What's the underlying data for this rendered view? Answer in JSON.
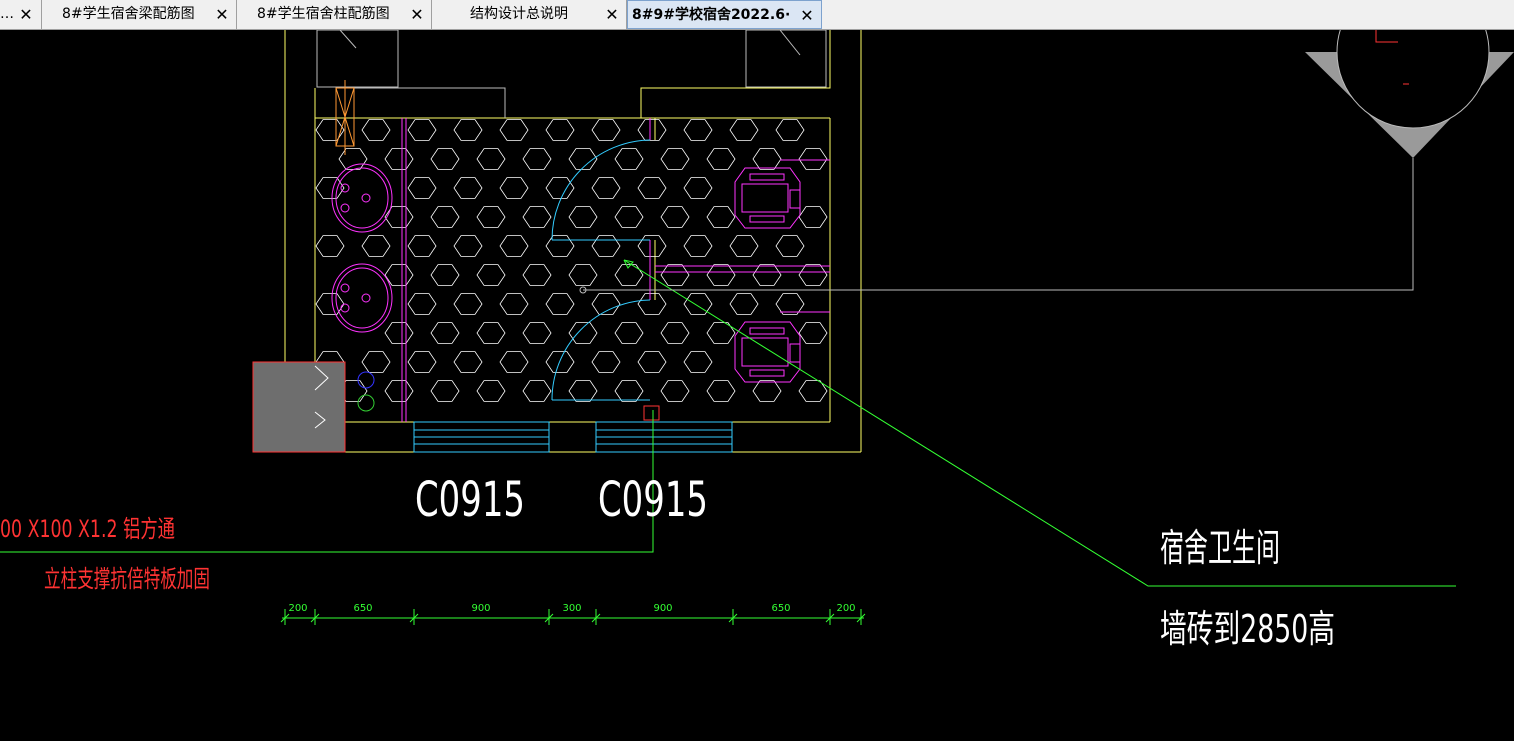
{
  "tabs": [
    {
      "label": "…",
      "active": false
    },
    {
      "label": "8#学生宿舍梁配筋图",
      "active": false
    },
    {
      "label": "8#学生宿舍柱配筋图",
      "active": false
    },
    {
      "label": "结构设计总说明",
      "active": false
    },
    {
      "label": "8#9#学校宿舍2022.6·",
      "active": true
    }
  ],
  "close_glyph": "✕",
  "drawing": {
    "window_labels": [
      "C0915",
      "C0915"
    ],
    "note_red": {
      "line1": "00 X100 X1.2 铝方通",
      "line2": "立柱支撑抗倍特板加固"
    },
    "note_white": {
      "line1": "宿舍卫生间",
      "line2": "墙砖到2850高"
    },
    "dimensions": [
      "200",
      "650",
      "900",
      "300",
      "900",
      "650",
      "200"
    ],
    "colors": {
      "wall": "#ffff66",
      "fixture": "#ff33ff",
      "door": "#33ccff",
      "leader": "#33ff33",
      "note_red": "#ff3333",
      "dimension": "#33ff33",
      "text": "#ffffff"
    }
  }
}
